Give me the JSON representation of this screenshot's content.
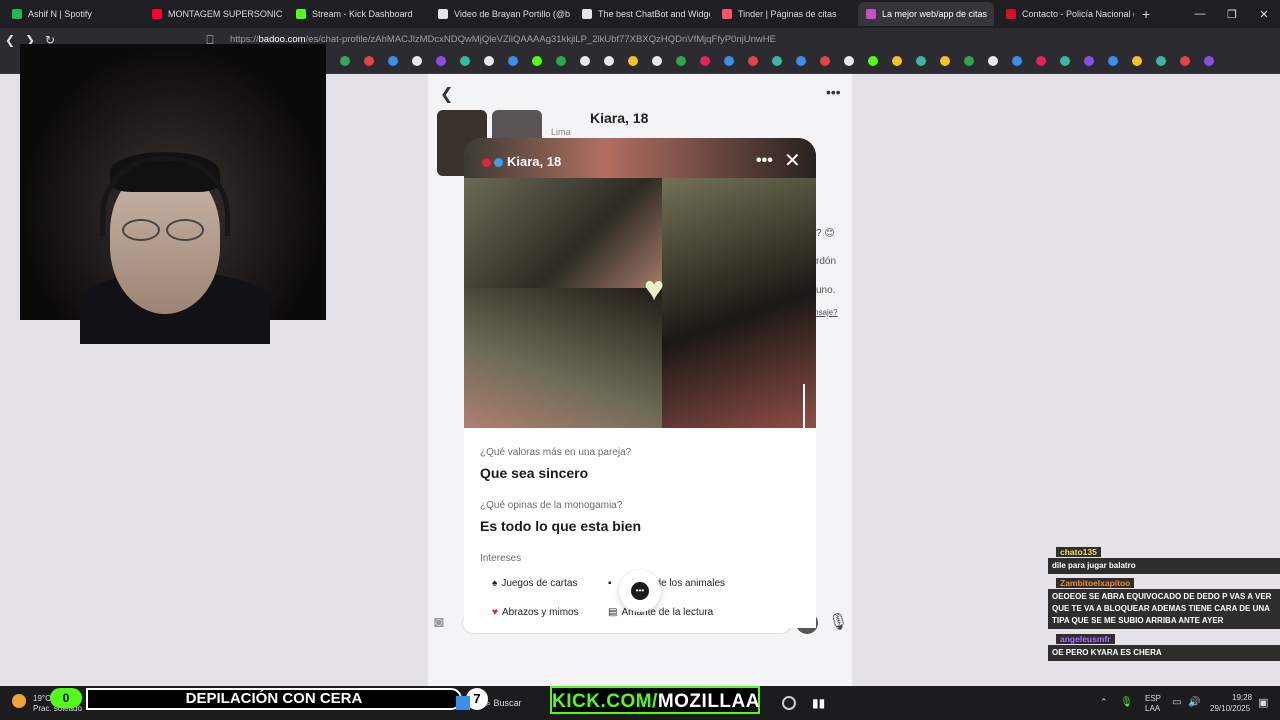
{
  "browser": {
    "tabs": [
      {
        "label": "Ashif N | Spotify",
        "color": "#1db954",
        "active": false
      },
      {
        "label": "MONTAGEM SUPERSONIC (Sle",
        "color": "#ff0033",
        "active": false
      },
      {
        "label": "Stream - Kick Dashboard",
        "color": "#53fc18",
        "active": false
      },
      {
        "label": "Video de Brayan Portillo (@bra",
        "color": "#e6e6e6",
        "active": false
      },
      {
        "label": "The best ChatBot and Widgets",
        "color": "#e6e6e6",
        "active": false
      },
      {
        "label": "Tinder | Páginas de citas",
        "color": "#fd5068",
        "active": false
      },
      {
        "label": "La mejor web/app de citas",
        "color": "#c74ec5",
        "active": true
      },
      {
        "label": "Contacto - Policía Nacional del",
        "color": "#d91023",
        "active": false
      }
    ],
    "new_tab": "+",
    "url_prefix": "https://",
    "url_domain": "badoo.com",
    "url_rest": "/es/chat-profile/zAhMACJlzMDcxNDQwMjQleVZliQAAAAg31kkjiLP_2lkUbf77XBXQzHQDnVfMjqFfyP0njUnwHE"
  },
  "chat": {
    "header_name": "Kiara, 18",
    "header_sub": "Lima",
    "bg_messages": [
      "? 😊",
      "rdón",
      "uno.",
      "nsaje?"
    ]
  },
  "modal": {
    "name": "Kiara, 18",
    "more": "•••",
    "close": "✕",
    "heart": "♥",
    "q1_label": "¿Qué valoras más en una pareja?",
    "q1_value": "Que sea sincero",
    "q2_label": "¿Qué opinas de la monogamia?",
    "q2_value": "Es todo lo que esta bien",
    "interests_label": "Intereses",
    "interests": [
      "Juegos de cartas",
      "de los animales",
      "Abrazos y mimos",
      "Amante de la lectura"
    ],
    "chat_fab": "•••"
  },
  "stream_chat": [
    {
      "user": "chato135",
      "user_color": "#f5e14b",
      "message": "dile para jugar balatro"
    },
    {
      "user": "Zambitoelxapitoo",
      "user_color": "#f08a24",
      "message": "OEOEOE SE ABRA EQUIVOCADO DE DEDO P VAS A VER QUE TE VA A BLOQUEAR ADEMAS TIENE CARA DE UNA TIPA QUE SE ME SUBIO ARRIBA ANTE AYER"
    },
    {
      "user": "angeleusmfr",
      "user_color": "#a970ff",
      "message": "OE PERO KYARA ES CHERA"
    }
  ],
  "overlay": {
    "badge_count": "0",
    "banner": "DEPILACIÓN CON CERA",
    "step": "7",
    "kick_prefix": "KICK.COM/",
    "kick_name": "MOZILLAA"
  },
  "taskbar": {
    "weather_temp": "19°C",
    "weather_desc": "Prac. soleado",
    "search": "Buscar",
    "lang_top": "ESP",
    "lang_bottom": "LAA",
    "time": "19:28",
    "date": "29/10/2025"
  }
}
